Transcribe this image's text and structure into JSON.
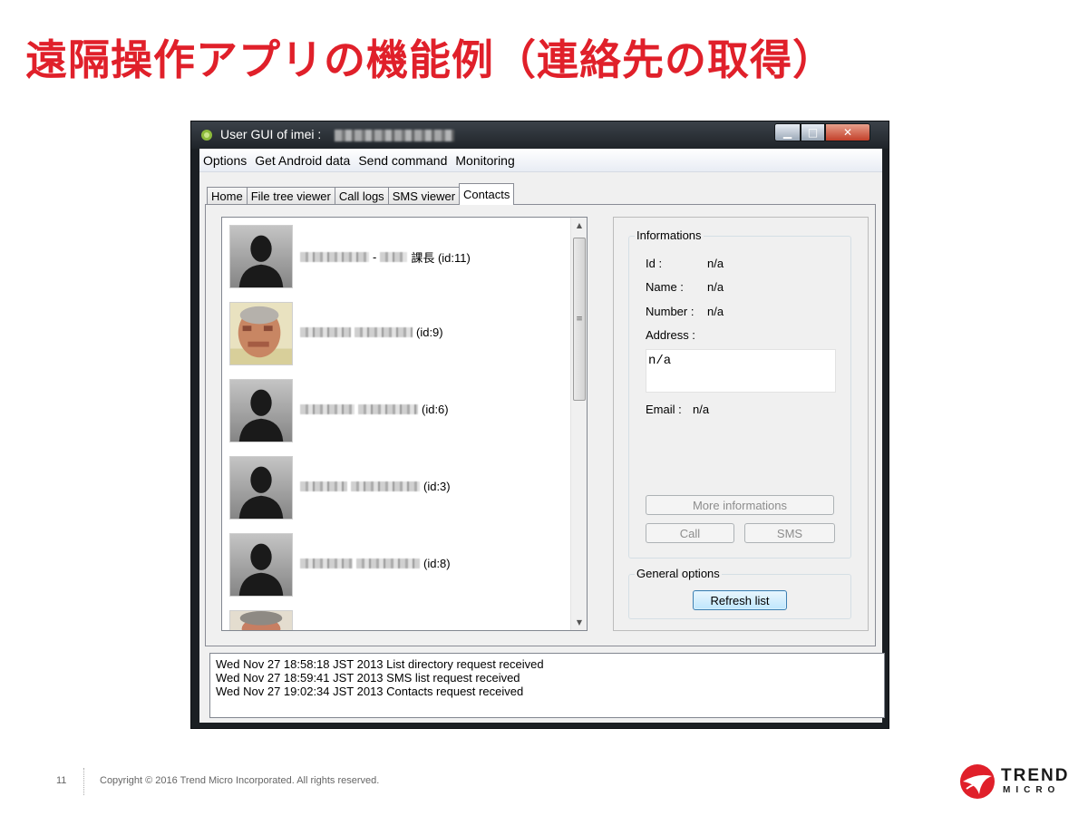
{
  "slide": {
    "title": "遠隔操作アプリの機能例（連絡先の取得）",
    "page_number": "11",
    "copyright": "Copyright © 2016 Trend Micro Incorporated. All rights reserved.",
    "logo": {
      "line1": "TREND",
      "line2": "MICRO",
      "color": "#e0202a"
    }
  },
  "window": {
    "title": "User GUI of imei :",
    "menu": [
      "Options",
      "Get Android data",
      "Send command",
      "Monitoring"
    ],
    "tabs": [
      "Home",
      "File tree viewer",
      "Call logs",
      "SMS viewer",
      "Contacts"
    ],
    "active_tab": "Contacts",
    "contacts": [
      {
        "suffix": "課長 (id:11)",
        "avatar": "silhouette"
      },
      {
        "suffix": "(id:9)",
        "avatar": "photo"
      },
      {
        "suffix": "(id:6)",
        "avatar": "silhouette"
      },
      {
        "suffix": "(id:3)",
        "avatar": "silhouette"
      },
      {
        "suffix": "(id:8)",
        "avatar": "silhouette"
      }
    ],
    "informations": {
      "title": "Informations",
      "id_label": "Id :",
      "id_value": "n/a",
      "name_label": "Name :",
      "name_value": "n/a",
      "number_label": "Number :",
      "number_value": "n/a",
      "address_label": "Address :",
      "address_value": "n/a",
      "email_label": "Email :",
      "email_value": "n/a",
      "more_button": "More informations",
      "call_button": "Call",
      "sms_button": "SMS"
    },
    "general_options": {
      "title": "General options",
      "refresh_button": "Refresh list"
    },
    "log": [
      "Wed Nov 27 18:58:18 JST 2013 List directory request received",
      "Wed Nov 27 18:59:41 JST 2013 SMS list request received",
      "Wed Nov 27 19:02:34 JST 2013 Contacts request received"
    ]
  }
}
